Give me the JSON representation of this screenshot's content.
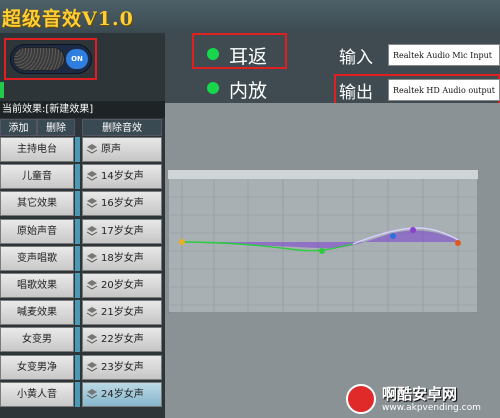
{
  "app": {
    "title": "超级音效V1.0"
  },
  "toggle": {
    "state_label": "ON"
  },
  "left_panel": {
    "current_effect_label": "当前效果:[新建效果]",
    "headers": {
      "add": "添加",
      "delete": "删除",
      "delete_effect": "删除音效"
    },
    "presets": [
      "主持电台",
      "儿童音",
      "其它效果",
      "原始声音",
      "变声唱歌",
      "唱歌效果",
      "喊麦效果",
      "女变男",
      "女变男净",
      "小黄人音"
    ],
    "effects": [
      "原声",
      "14岁女声",
      "16岁女声",
      "17岁女声",
      "18岁女声",
      "20岁女声",
      "21岁女声",
      "22岁女声",
      "23岁女声",
      "24岁女声"
    ],
    "selected_effect_index": 9
  },
  "monitor": {
    "earback_label": "耳返",
    "internal_label": "内放"
  },
  "io": {
    "input_label": "输入",
    "input_device": "Realtek Audio Mic Input",
    "output_label": "输出",
    "output_device": "Realtek HD Audio output"
  },
  "watermark": {
    "text": "啊酷安卓网",
    "url": "www.akpvending.com"
  },
  "colors": {
    "title": "#ffcf33",
    "accent": "#2f7fe0",
    "indicator": "#17d64b",
    "highlight_box": "#e02020"
  }
}
